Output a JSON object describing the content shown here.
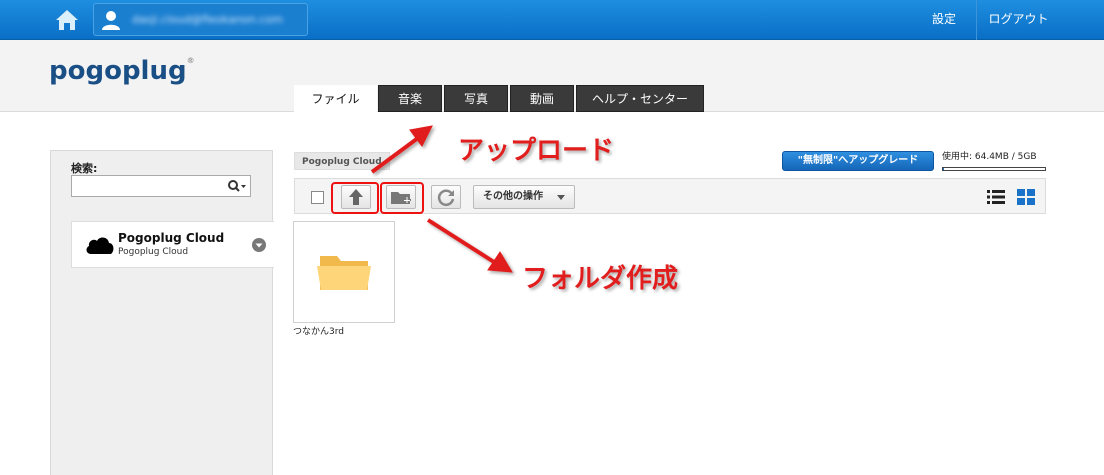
{
  "topbar": {
    "user_email": "dasji.cloud@fleokanon.com",
    "settings_label": "設定",
    "logout_label": "ログアウト"
  },
  "header": {
    "logo_text": "pogoplug",
    "tabs": [
      {
        "label": "ファイル",
        "active": true
      },
      {
        "label": "音楽",
        "active": false
      },
      {
        "label": "写真",
        "active": false
      },
      {
        "label": "動画",
        "active": false
      },
      {
        "label": "ヘルプ・センター",
        "active": false
      }
    ]
  },
  "sidebar": {
    "search_label": "検索:",
    "search_value": "",
    "cloud_title": "Pogoplug Cloud",
    "cloud_subtitle": "Pogoplug Cloud"
  },
  "main": {
    "breadcrumb": "Pogoplug Cloud",
    "upgrade_label": "\"無制限\"へアップグレード",
    "usage_text": "使用中: 64.4MB / 5GB",
    "usage_fraction": 0.0126,
    "more_actions_label": "その他の操作",
    "files": [
      {
        "name": "つなかん3rd",
        "type": "folder"
      }
    ]
  },
  "annotations": {
    "upload": "アップロード",
    "new_folder": "フォルダ作成",
    "color": "#e11d1d"
  },
  "colors": {
    "topbar": "#0a6fc6",
    "logo": "#1a4f86",
    "tab_dark": "#3a3a3a",
    "accent_blue": "#1a73c9"
  },
  "icons": [
    "home-icon",
    "user-icon",
    "search-icon",
    "cloud-icon",
    "chevron-down-icon",
    "upload-arrow-icon",
    "new-folder-icon",
    "refresh-icon",
    "list-view-icon",
    "grid-view-icon",
    "folder-icon"
  ]
}
